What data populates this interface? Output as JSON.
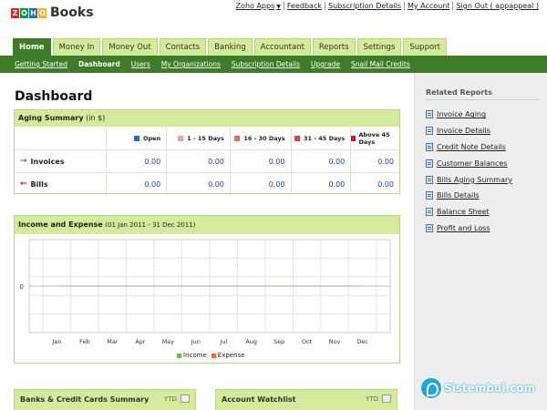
{
  "app": {
    "logo_letters": [
      "Z",
      "O",
      "H",
      "O"
    ],
    "logo_colors": [
      "#e42527",
      "#089949",
      "#226db4",
      "#f9b21d"
    ],
    "name": "Books"
  },
  "top_links": {
    "apps": "Zoho Apps",
    "feedback": "Feedback",
    "subscription": "Subscription Details",
    "account": "My Account",
    "signout": "Sign Out ( appappeal )"
  },
  "tabs": [
    "Home",
    "Money In",
    "Money Out",
    "Contacts",
    "Banking",
    "Accountant",
    "Reports",
    "Settings",
    "Support"
  ],
  "active_tab": "Home",
  "subnav": [
    "Getting Started",
    "Dashboard",
    "Users",
    "My Organizations",
    "Subscription Details",
    "Upgrade",
    "Snail Mail Credits"
  ],
  "active_subnav": "Dashboard",
  "page_title": "Dashboard",
  "aging": {
    "title": "Aging Summary",
    "unit": "(in $)",
    "columns": [
      {
        "label": "Open",
        "color": "#1e6fd9"
      },
      {
        "label": "1 - 15 Days",
        "color": "#f0a0a0"
      },
      {
        "label": "16 - 30 Days",
        "color": "#e07070"
      },
      {
        "label": "31 - 45 Days",
        "color": "#d84848"
      },
      {
        "label": "Above 45 Days",
        "color": "#e01010"
      }
    ],
    "rows": [
      {
        "label": "Invoices",
        "arrow": "→",
        "arrow_color": "#2e9a2e",
        "values": [
          "0.00",
          "0.00",
          "0.00",
          "0.00",
          "0.00"
        ]
      },
      {
        "label": "Bills",
        "arrow": "←",
        "arrow_color": "#c82020",
        "values": [
          "0.00",
          "0.00",
          "0.00",
          "0.00",
          "0.00"
        ]
      }
    ]
  },
  "income_expense": {
    "title": "Income and Expense",
    "range": "(01 Jan 2011 - 31 Dec 2011)",
    "legend": [
      {
        "name": "Income",
        "color": "#5fbf3f"
      },
      {
        "name": "Expense",
        "color": "#f07020"
      }
    ]
  },
  "chart_data": {
    "type": "line",
    "categories": [
      "Jan",
      "Feb",
      "Mar",
      "Apr",
      "May",
      "Jun",
      "Jul",
      "Aug",
      "Sep",
      "Oct",
      "Nov",
      "Dec"
    ],
    "y_tick_label": "0",
    "series": [
      {
        "name": "Income",
        "values": [
          0,
          0,
          0,
          0,
          0,
          0,
          0,
          0,
          0,
          0,
          0,
          0
        ]
      },
      {
        "name": "Expense",
        "values": [
          0,
          0,
          0,
          0,
          0,
          0,
          0,
          0,
          0,
          0,
          0,
          0
        ]
      }
    ]
  },
  "related_reports": {
    "title": "Related Reports",
    "items": [
      "Invoice Aging",
      "Invoice Details",
      "Credit Note Details",
      "Customer Balances",
      "Bills Aging Summary",
      "Bills Details",
      "Balance Sheet",
      "Profit and Loss"
    ]
  },
  "bottom_panels": [
    {
      "title": "Banks & Credit Cards Summary",
      "tag": "YTD"
    },
    {
      "title": "Account Watchlist",
      "tag": "YTD"
    }
  ],
  "watermark": "Sistembul.com"
}
